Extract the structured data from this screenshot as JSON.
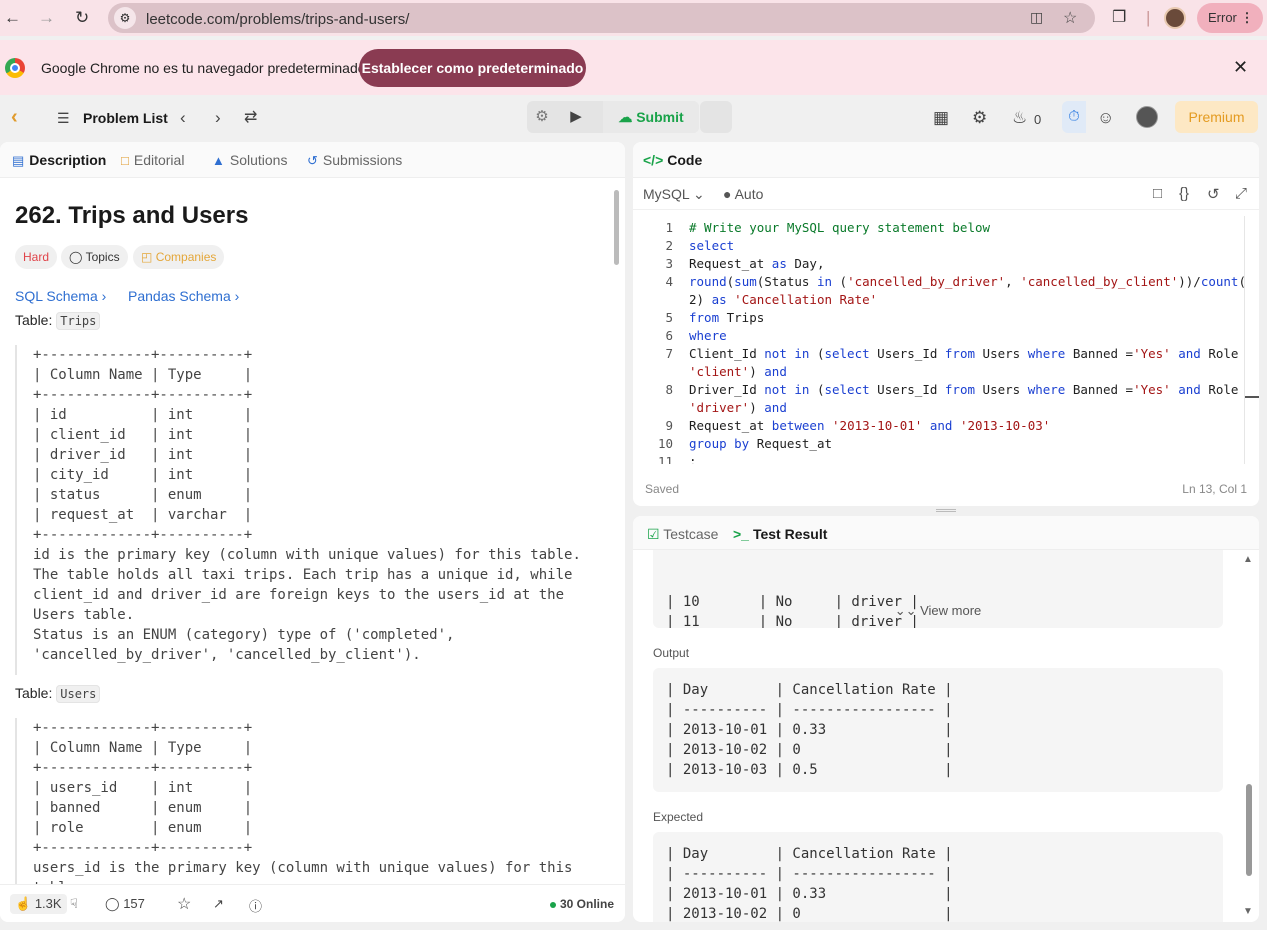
{
  "browser": {
    "url": "leetcode.com/problems/trips-and-users/",
    "error_label": "Error",
    "infobar_message": "Google Chrome no es tu navegador predeterminado",
    "infobar_button": "Establecer como predeterminado"
  },
  "header": {
    "problem_list": "Problem List",
    "submit": "Submit",
    "streak_count": "0",
    "premium": "Premium"
  },
  "tabs": {
    "description": "Description",
    "editorial": "Editorial",
    "solutions": "Solutions",
    "submissions": "Submissions"
  },
  "problem": {
    "title": "262. Trips and Users",
    "difficulty": "Hard",
    "topics": "Topics",
    "companies": "Companies",
    "sql_schema": "SQL Schema",
    "pandas_schema": "Pandas Schema",
    "table_label": "Table:",
    "trips_name": "Trips",
    "trips_schema": "+-------------+----------+\n| Column Name | Type     |\n+-------------+----------+\n| id          | int      |\n| client_id   | int      |\n| driver_id   | int      |\n| city_id     | int      |\n| status      | enum     |\n| request_at  | varchar  |\n+-------------+----------+\nid is the primary key (column with unique values) for this table.\nThe table holds all taxi trips. Each trip has a unique id, while\nclient_id and driver_id are foreign keys to the users_id at the\nUsers table.\nStatus is an ENUM (category) type of ('completed',\n'cancelled_by_driver', 'cancelled_by_client').",
    "users_name": "Users",
    "users_schema": "+-------------+----------+\n| Column Name | Type     |\n+-------------+----------+\n| users_id    | int      |\n| banned      | enum     |\n| role        | enum     |\n+-------------+----------+\nusers_id is the primary key (column with unique values) for this\ntable."
  },
  "footer": {
    "likes": "1.3K",
    "comments": "157",
    "online": "30 Online"
  },
  "code_panel": {
    "title": "Code",
    "language": "MySQL",
    "auto": "Auto",
    "status": "Saved",
    "cursor": "Ln 13, Col 1",
    "line_numbers": [
      "1",
      "2",
      "3",
      "4",
      "",
      "5",
      "6",
      "7",
      "",
      "8",
      "",
      "9",
      "10",
      "11"
    ]
  },
  "test_panel": {
    "testcase_tab": "Testcase",
    "result_tab": "Test Result",
    "input_tail": "| 10       | No     | driver |\n| 11       | No     | driver |",
    "view_more": "View more",
    "output_label": "Output",
    "output_table": "| Day        | Cancellation Rate |\n| ---------- | ----------------- |\n| 2013-10-01 | 0.33              |\n| 2013-10-02 | 0                 |\n| 2013-10-03 | 0.5               |",
    "expected_label": "Expected",
    "expected_table": "| Day        | Cancellation Rate |\n| ---------- | ----------------- |\n| 2013-10-01 | 0.33              |\n| 2013-10-02 | 0                 |"
  }
}
